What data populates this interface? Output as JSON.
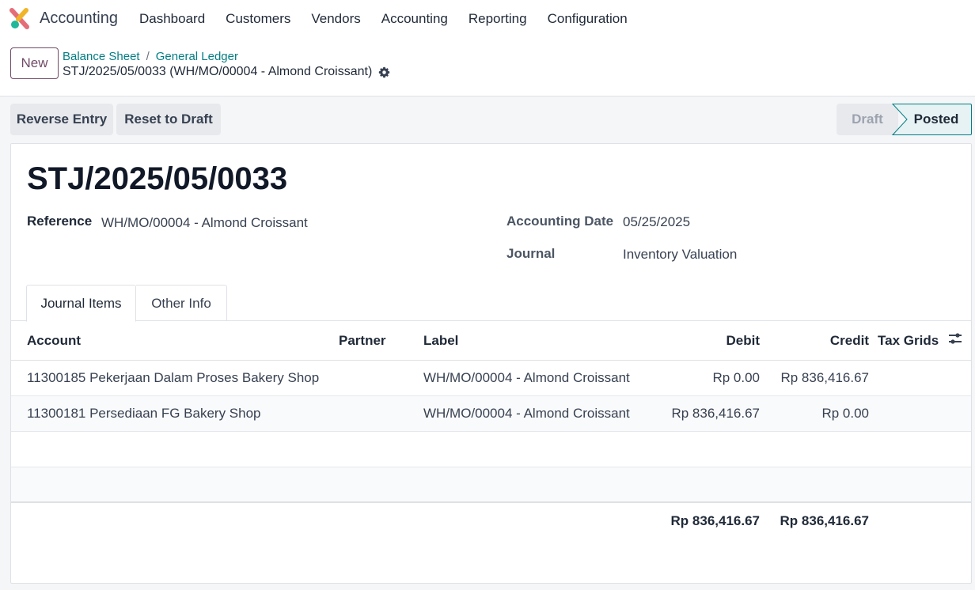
{
  "nav": {
    "app_name": "Accounting",
    "menu": [
      "Dashboard",
      "Customers",
      "Vendors",
      "Accounting",
      "Reporting",
      "Configuration"
    ]
  },
  "control": {
    "new_label": "New",
    "breadcrumbs": [
      "Balance Sheet",
      "General Ledger"
    ],
    "breadcrumb_sep": "/",
    "record_name": "STJ/2025/05/0033 (WH/MO/00004 - Almond Croissant)"
  },
  "actions": {
    "reverse": "Reverse Entry",
    "reset": "Reset to Draft"
  },
  "status": {
    "stages": [
      "Draft",
      "Posted"
    ],
    "current": "Posted"
  },
  "form": {
    "title": "STJ/2025/05/0033",
    "reference_label": "Reference",
    "reference_value": "WH/MO/00004 - Almond Croissant",
    "date_label": "Accounting Date",
    "date_value": "05/25/2025",
    "journal_label": "Journal",
    "journal_value": "Inventory Valuation"
  },
  "tabs": [
    "Journal Items",
    "Other Info"
  ],
  "table": {
    "headers": [
      "Account",
      "Partner",
      "Label",
      "Debit",
      "Credit",
      "Tax Grids"
    ],
    "rows": [
      {
        "account": "11300185 Pekerjaan Dalam Proses Bakery Shop",
        "partner": "",
        "label": "WH/MO/00004 - Almond Croissant",
        "debit": "Rp 0.00",
        "credit": "Rp 836,416.67"
      },
      {
        "account": "11300181 Persediaan FG Bakery Shop",
        "partner": "",
        "label": "WH/MO/00004 - Almond Croissant",
        "debit": "Rp 836,416.67",
        "credit": "Rp 0.00"
      }
    ],
    "total_debit": "Rp 836,416.67",
    "total_credit": "Rp 836,416.67"
  },
  "colors": {
    "brand": "#714b67",
    "link": "#017e84",
    "status_active_border": "#017e84"
  },
  "icons": {
    "logo": "odoo-accounting-logo",
    "record_settings": "gear-icon",
    "optional_columns": "sliders-icon"
  }
}
